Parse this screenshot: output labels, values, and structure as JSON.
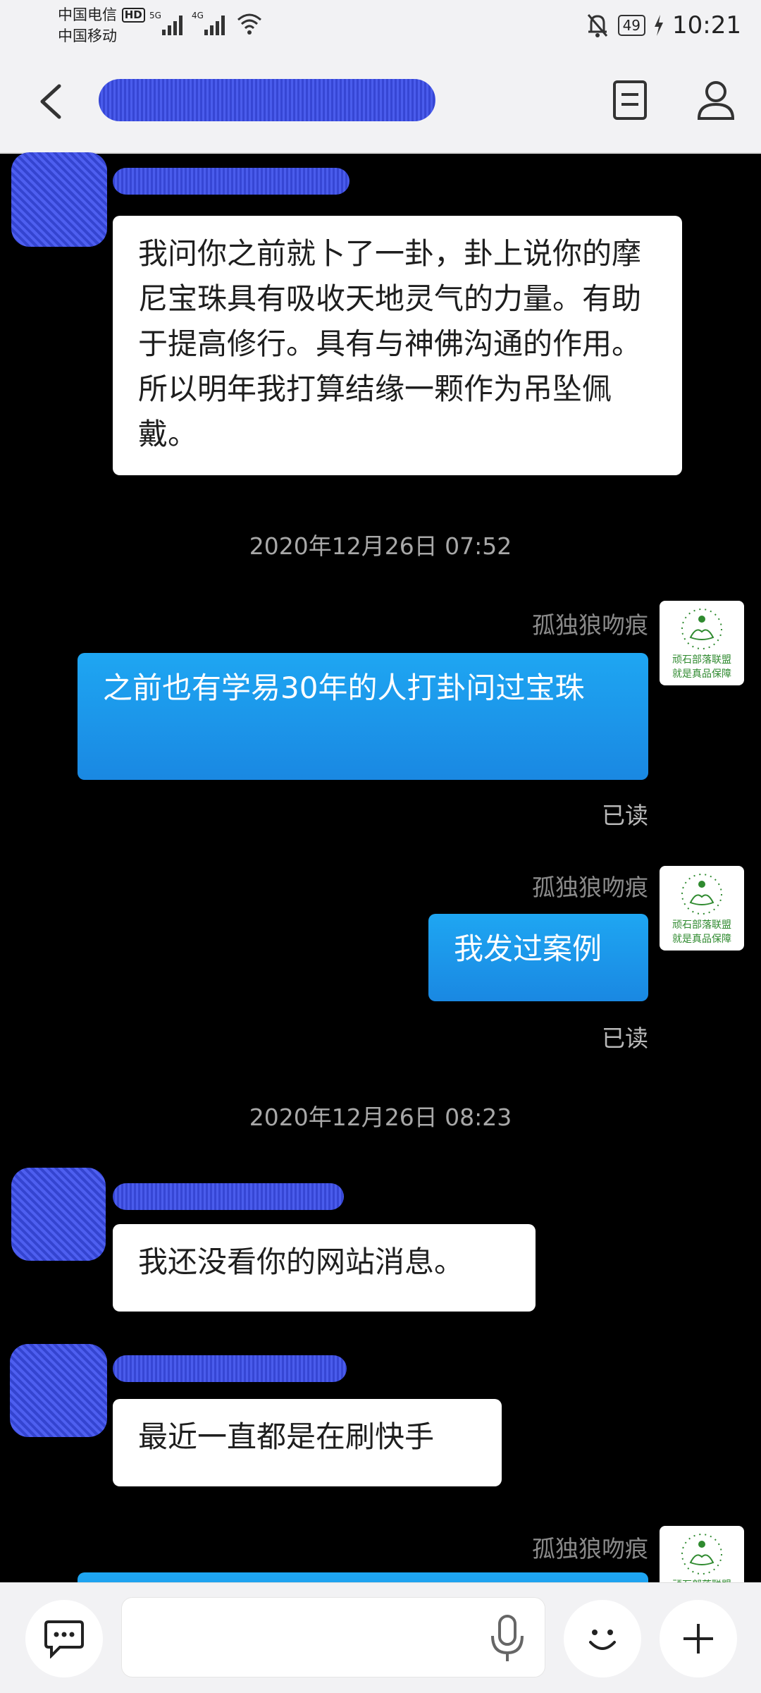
{
  "status_bar": {
    "carrier_primary": "中国电信",
    "carrier_badge": "HD",
    "carrier_secondary": "中国移动",
    "network_5g": "5G",
    "network_4g": "4G",
    "battery": "49",
    "time": "10:21",
    "icons": [
      "signal-icon",
      "wifi-icon",
      "mute-bell-icon",
      "battery-icon",
      "charging-icon"
    ]
  },
  "header": {
    "icons": [
      "back-arrow-icon",
      "document-icon",
      "person-icon"
    ]
  },
  "messages": {
    "m1_text": "我问你之前就卜了一卦，卦上说你的摩尼宝珠具有吸收天地灵气的力量。有助于提高修行。具有与神佛沟通的作用。所以明年我打算结缘一颗作为吊坠佩戴。",
    "ts1": "2020年12月26日 07:52",
    "sender_name": "孤独狼吻痕",
    "m2_text": "之前也有学易30年的人打卦问过宝珠",
    "m2_status": "已读",
    "m3_text": "我发过案例",
    "m3_status": "已读",
    "ts2": "2020年12月26日 08:23",
    "m4_text": "我还没看你的网站消息。",
    "m5_text": "最近一直都是在刷快手"
  },
  "logo": {
    "line1": "顽石部落联盟",
    "line2": "就是真品保障",
    "color": "#2f8a2f"
  },
  "input_bar": {
    "icons": [
      "chat-bubble-icon",
      "microphone-icon",
      "smiley-icon",
      "plus-icon"
    ]
  },
  "colors": {
    "accent": "#1a8fe6",
    "redaction": "#3a4ad8",
    "chat_background": "#000000"
  }
}
